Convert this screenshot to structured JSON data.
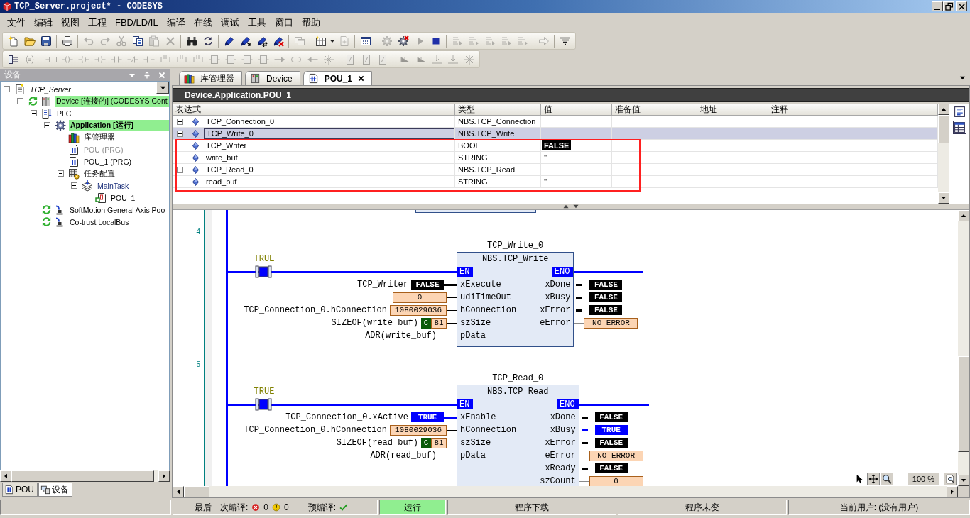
{
  "window": {
    "title": "TCP_Server.project* - CODESYS"
  },
  "menu": [
    "文件",
    "编辑",
    "视图",
    "工程",
    "FBD/LD/IL",
    "编译",
    "在线",
    "调试",
    "工具",
    "窗口",
    "帮助"
  ],
  "toolbars": [
    {
      "groups": [
        [
          {
            "kind": "new",
            "disabled": false
          },
          {
            "kind": "open",
            "disabled": false
          },
          {
            "kind": "save",
            "disabled": false
          }
        ],
        [
          {
            "kind": "print",
            "disabled": false
          }
        ],
        [
          {
            "kind": "undo",
            "disabled": true
          },
          {
            "kind": "redo",
            "disabled": true
          },
          {
            "kind": "cut",
            "disabled": true
          },
          {
            "kind": "copy",
            "disabled": false
          },
          {
            "kind": "paste",
            "disabled": true
          },
          {
            "kind": "delete",
            "disabled": true
          }
        ],
        [
          {
            "kind": "find",
            "disabled": false
          },
          {
            "kind": "replace",
            "disabled": false
          }
        ],
        [
          {
            "kind": "pen",
            "disabled": false
          },
          {
            "kind": "penarrow",
            "disabled": false
          },
          {
            "kind": "penarrows",
            "disabled": false
          },
          {
            "kind": "pencross",
            "disabled": false
          }
        ],
        [
          {
            "kind": "windows",
            "disabled": true
          }
        ],
        [
          {
            "kind": "table",
            "disabled": false
          },
          {
            "kind": "caret",
            "disabled": false
          },
          {
            "kind": "page",
            "disabled": true
          }
        ],
        [
          {
            "kind": "dots",
            "disabled": false
          }
        ],
        [
          {
            "kind": "gear",
            "disabled": true
          },
          {
            "kind": "gearcross",
            "disabled": false
          },
          {
            "kind": "play",
            "disabled": true
          },
          {
            "kind": "stop",
            "disabled": false
          }
        ],
        [
          {
            "kind": "linesarrow",
            "disabled": true
          },
          {
            "kind": "linesarrow",
            "disabled": true
          },
          {
            "kind": "linesarrow",
            "disabled": true
          },
          {
            "kind": "linesarrow",
            "disabled": true
          },
          {
            "kind": "linesarrow",
            "disabled": true
          }
        ],
        [
          {
            "kind": "rightarrow",
            "disabled": true
          }
        ],
        [
          {
            "kind": "filter",
            "disabled": false
          }
        ]
      ]
    },
    {
      "groups": [
        [
          {
            "kind": "network",
            "disabled": false
          },
          {
            "kind": "assign",
            "disabled": true
          }
        ],
        [
          {
            "kind": "var",
            "disabled": true
          },
          {
            "kind": "coil",
            "disabled": true
          },
          {
            "kind": "coil",
            "disabled": true
          },
          {
            "kind": "coil",
            "disabled": true
          },
          {
            "kind": "contact",
            "disabled": true
          },
          {
            "kind": "contactneg",
            "disabled": true
          },
          {
            "kind": "contact",
            "disabled": true
          },
          {
            "kind": "parallel",
            "disabled": true
          },
          {
            "kind": "parallel",
            "disabled": true
          },
          {
            "kind": "parallel",
            "disabled": true
          },
          {
            "kind": "block",
            "disabled": true
          },
          {
            "kind": "block",
            "disabled": true
          },
          {
            "kind": "block",
            "disabled": true
          },
          {
            "kind": "block",
            "disabled": true
          },
          {
            "kind": "jump",
            "disabled": true
          },
          {
            "kind": "label",
            "disabled": true
          },
          {
            "kind": "ret",
            "disabled": true
          },
          {
            "kind": "spark",
            "disabled": true
          }
        ],
        [
          {
            "kind": "boxf",
            "disabled": true
          },
          {
            "kind": "boxf",
            "disabled": true
          },
          {
            "kind": "boxf",
            "disabled": true
          }
        ],
        [
          {
            "kind": "branch",
            "disabled": true
          },
          {
            "kind": "branch",
            "disabled": true
          },
          {
            "kind": "insert",
            "disabled": true
          },
          {
            "kind": "insert",
            "disabled": true
          },
          {
            "kind": "spark",
            "disabled": true
          }
        ]
      ]
    }
  ],
  "device_panel": {
    "title": "设备",
    "tree": [
      {
        "label": "TCP_Server",
        "kind": "project",
        "expanded": true,
        "online": false,
        "highlighted": false,
        "active": false,
        "excluded": false,
        "children": [
          {
            "label": "Device [连接的] (CODESYS Cont",
            "kind": "device",
            "expanded": true,
            "online": true,
            "highlighted": true,
            "active": false,
            "excluded": false,
            "children": [
              {
                "label": "PLC",
                "kind": "plc",
                "expanded": true,
                "online": false,
                "highlighted": false,
                "active": false,
                "excluded": false,
                "children": [
                  {
                    "label": "Application [运行]",
                    "kind": "application",
                    "expanded": true,
                    "online": false,
                    "highlighted": true,
                    "active": true,
                    "excluded": false,
                    "children": [
                      {
                        "label": "库管理器",
                        "kind": "library",
                        "online": false,
                        "highlighted": false,
                        "active": false,
                        "excluded": false
                      },
                      {
                        "label": "POU (PRG)",
                        "kind": "pou",
                        "online": false,
                        "highlighted": false,
                        "active": false,
                        "excluded": true
                      },
                      {
                        "label": "POU_1 (PRG)",
                        "kind": "pou",
                        "online": false,
                        "highlighted": false,
                        "active": false,
                        "excluded": false
                      },
                      {
                        "label": "任务配置",
                        "kind": "tasks",
                        "expanded": true,
                        "online": false,
                        "highlighted": false,
                        "active": false,
                        "excluded": false,
                        "children": [
                          {
                            "label": "MainTask",
                            "kind": "task",
                            "expanded": true,
                            "online": false,
                            "highlighted": false,
                            "active": false,
                            "excluded": false,
                            "children": [
                              {
                                "label": "POU_1",
                                "kind": "call",
                                "online": false,
                                "highlighted": false,
                                "active": false,
                                "excluded": false
                              }
                            ]
                          }
                        ]
                      }
                    ]
                  }
                ]
              },
              {
                "label": "SoftMotion General Axis Poo",
                "kind": "bus",
                "online": true,
                "highlighted": false,
                "active": false,
                "excluded": false
              },
              {
                "label": "Co-trust LocalBus",
                "kind": "bus",
                "online": true,
                "highlighted": false,
                "active": false,
                "excluded": false
              }
            ]
          }
        ]
      }
    ],
    "tabs": [
      {
        "label": "POU",
        "kind": "pou",
        "selected": false
      },
      {
        "label": "设备",
        "kind": "devices",
        "selected": true
      }
    ]
  },
  "editor": {
    "tabs": [
      {
        "label": "库管理器",
        "kind": "library",
        "selected": false,
        "closable": false
      },
      {
        "label": "Device",
        "kind": "device",
        "selected": false,
        "closable": false
      },
      {
        "label": "POU_1",
        "kind": "pou",
        "selected": true,
        "closable": true
      }
    ],
    "path": "Device.Application.POU_1",
    "watch": {
      "columns": [
        "表达式",
        "类型",
        "值",
        "准备值",
        "地址",
        "注释"
      ],
      "rows": [
        {
          "expression": "TCP_Connection_0",
          "type": "NBS.TCP_Connection",
          "kind": "instance",
          "expandable": true,
          "selected": false,
          "highlighted": false
        },
        {
          "expression": "TCP_Write_0",
          "type": "NBS.TCP_Write",
          "kind": "instance",
          "expandable": true,
          "selected": true,
          "highlighted": false
        },
        {
          "expression": "TCP_Writer",
          "type": "BOOL",
          "value": "FALSE",
          "kind": "bool",
          "on": false,
          "expandable": false,
          "selected": false,
          "highlighted": true
        },
        {
          "expression": "write_buf",
          "type": "STRING",
          "value": "''",
          "kind": "text",
          "expandable": false,
          "selected": false,
          "highlighted": true
        },
        {
          "expression": "TCP_Read_0",
          "type": "NBS.TCP_Read",
          "kind": "instance",
          "expandable": true,
          "selected": false,
          "highlighted": true
        },
        {
          "expression": "read_buf",
          "type": "STRING",
          "value": "''",
          "kind": "text",
          "expandable": false,
          "selected": false,
          "highlighted": true
        }
      ]
    },
    "networks": [
      {
        "number": "4",
        "contact": {
          "label": "TRUE",
          "on": true
        },
        "instance": "TCP_Write_0",
        "type": "NBS.TCP_Write",
        "en": "EN",
        "eno": "ENO",
        "inputs": [
          {
            "pin": "xExecute",
            "variable": "TCP_Writer",
            "value": "FALSE",
            "kind": "bool",
            "on": false
          },
          {
            "pin": "udiTimeOut",
            "value": "0",
            "kind": "value"
          },
          {
            "pin": "hConnection",
            "variable": "TCP_Connection_0.hConnection",
            "value": "1080029036",
            "kind": "value"
          },
          {
            "pin": "szSize",
            "variable": "SIZEOF(write_buf)",
            "badge": "C",
            "value": "81",
            "kind": "constant"
          },
          {
            "pin": "pData",
            "variable": "ADR(write_buf)",
            "kind": "address"
          }
        ],
        "outputs": [
          {
            "pin": "xDone",
            "value": "FALSE",
            "kind": "bool",
            "on": false
          },
          {
            "pin": "xBusy",
            "value": "FALSE",
            "kind": "bool",
            "on": false
          },
          {
            "pin": "xError",
            "value": "FALSE",
            "kind": "bool",
            "on": false
          },
          {
            "pin": "eError",
            "value": "NO ERROR",
            "kind": "value"
          }
        ]
      },
      {
        "number": "5",
        "contact": {
          "label": "TRUE",
          "on": true
        },
        "instance": "TCP_Read_0",
        "type": "NBS.TCP_Read",
        "en": "EN",
        "eno": "ENO",
        "inputs": [
          {
            "pin": "xEnable",
            "variable": "TCP_Connection_0.xActive",
            "value": "TRUE",
            "kind": "bool",
            "on": true
          },
          {
            "pin": "hConnection",
            "variable": "TCP_Connection_0.hConnection",
            "value": "1080029036",
            "kind": "value"
          },
          {
            "pin": "szSize",
            "variable": "SIZEOF(read_buf)",
            "badge": "C",
            "value": "81",
            "kind": "constant"
          },
          {
            "pin": "pData",
            "variable": "ADR(read_buf)",
            "kind": "address"
          }
        ],
        "outputs": [
          {
            "pin": "xDone",
            "value": "FALSE",
            "kind": "bool",
            "on": false
          },
          {
            "pin": "xBusy",
            "value": "TRUE",
            "kind": "bool",
            "on": true
          },
          {
            "pin": "xError",
            "value": "FALSE",
            "kind": "bool",
            "on": false
          },
          {
            "pin": "eError",
            "value": "NO ERROR",
            "kind": "value"
          },
          {
            "pin": "xReady",
            "value": "FALSE",
            "kind": "bool",
            "on": false
          },
          {
            "pin": "szCount",
            "value": "0",
            "kind": "value"
          }
        ]
      }
    ],
    "zoom": "100 %"
  },
  "status_bar": {
    "build_label": "最后一次编译:",
    "errors": "0",
    "warnings": "0",
    "precompile_label": "预编译:",
    "precompile_ok": true,
    "fields": [
      {
        "text": "运行",
        "highlighted": true
      },
      {
        "text": "程序下载",
        "highlighted": false
      },
      {
        "text": "程序未变",
        "highlighted": false
      },
      {
        "text": "当前用户: (没有用户)",
        "highlighted": false
      }
    ]
  }
}
